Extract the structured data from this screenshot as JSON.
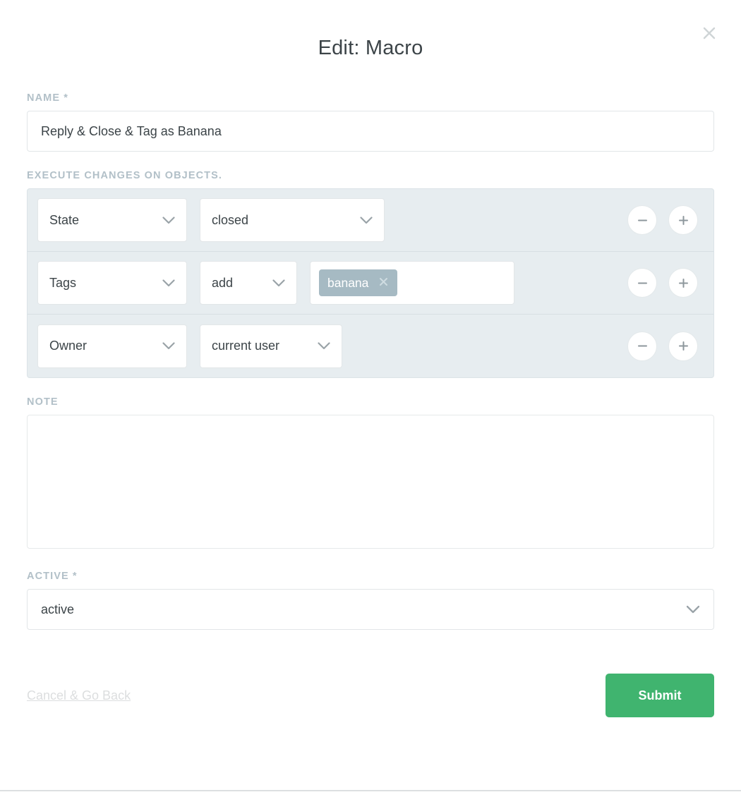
{
  "dialog": {
    "title": "Edit: Macro",
    "close_icon": "close-icon"
  },
  "name_field": {
    "label": "NAME",
    "required_mark": "*",
    "value": "Reply & Close & Tag as Banana",
    "placeholder": "Name"
  },
  "actions_section": {
    "label": "EXECUTE CHANGES ON OBJECTS.",
    "remove_icon": "minus-icon",
    "add_icon": "plus-icon",
    "rows": [
      {
        "attribute": "State",
        "value": "closed",
        "type": "select-pair"
      },
      {
        "attribute": "Tags",
        "operator": "add",
        "type": "tag-row",
        "tags": [
          "banana"
        ],
        "tag_remove_icon": "x-icon"
      },
      {
        "attribute": "Owner",
        "value": "current user",
        "type": "select-pair"
      }
    ]
  },
  "note_field": {
    "label": "NOTE",
    "value": "",
    "placeholder": ""
  },
  "active_field": {
    "label": "ACTIVE",
    "required_mark": "*",
    "value": "active"
  },
  "footer": {
    "cancel_label": "Cancel & Go Back",
    "submit_label": "Submit"
  },
  "colors": {
    "accent_green": "#40b46f",
    "panel_bg": "#e7edf0",
    "chip_bg": "#a6bac3",
    "label_gray": "#b2c0c8",
    "text_dark": "#3c4448"
  }
}
